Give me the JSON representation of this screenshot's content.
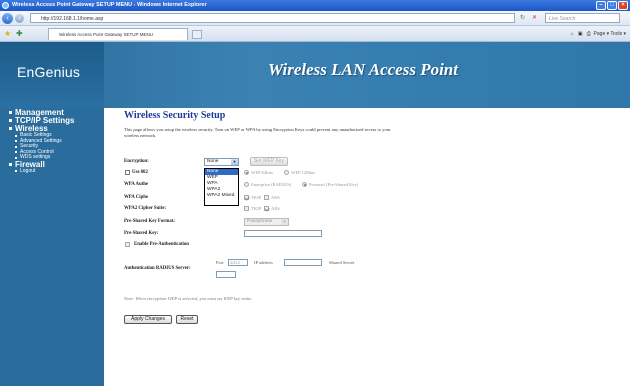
{
  "browser": {
    "window_title": "Wireless Access Point Gateway SETUP MENU - Windows Internet Explorer",
    "address": "http://192.168.1.1/home.asp",
    "search_placeholder": "Live Search",
    "tab_label": "Wireless Access Point Gateway SETUP MENU",
    "toolbar_right": "Page ▾   Tools ▾"
  },
  "banner": {
    "logo": "EnGenius",
    "title": "Wireless LAN Access Point"
  },
  "sidebar": {
    "management": "Management",
    "tcpip": "TCP/IP Settings",
    "wireless": "Wireless",
    "wireless_items": [
      "Basic Settings",
      "Advanced Settings",
      "Security",
      "Access Control",
      "WDS settings"
    ],
    "firewall": "Firewall",
    "logout": "Logout"
  },
  "page": {
    "title": "Wireless Security Setup",
    "description": "This page allows you setup the wireless security. Turn on WEP or WPA by using Encryption Keys could prevent any unauthorized access to your wireless network.",
    "encryption_label": "Encryption:",
    "encryption_value": "None",
    "encryption_options": [
      "None",
      "WEP",
      "WPA",
      "WPA2",
      "WPA2 Mixed"
    ],
    "set_wep_key": "Set WEP Key",
    "use_8021x_label": "Use 802",
    "wep_64": "WEP 64bits",
    "wep_128": "WEP 128bits",
    "wpa_auth_label": "WPA Authe",
    "enterprise": "Enterprise (RADIUS)",
    "personal": "Personal (Pre-Shared Key)",
    "wpa_cipher_label": "WPA Ciphe",
    "tkip": "TKIP",
    "aes": "AES",
    "wpa2_cipher_label": "WPA2 Cipher Suite:",
    "psk_format_label": "Pre-Shared Key Format:",
    "psk_format_value": "Passphrase",
    "psk_label": "Pre-Shared Key:",
    "pre_auth_label": "Enable Pre-Authentication",
    "radius_label": "Authentication RADIUS Server:",
    "port_label": "Port",
    "port_value": "1812",
    "ip_label": "IP address",
    "secret_label": "Shared Secret",
    "note": "Note: When encryption WEP is selected, you must set WEP key value.",
    "apply_button": "Apply Changes",
    "reset_button": "Reset"
  }
}
